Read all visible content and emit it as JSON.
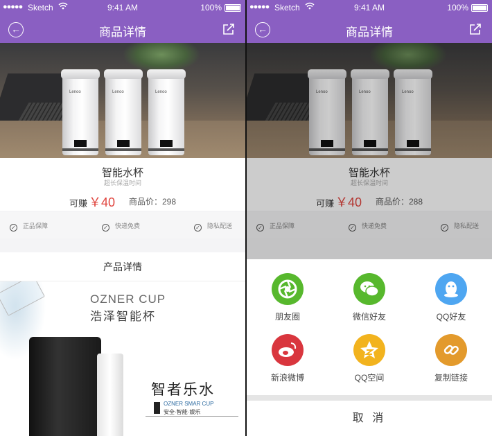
{
  "status_bar": {
    "signal": "●●●●●",
    "carrier": "Sketch",
    "time": "9:41 AM",
    "battery": "100%"
  },
  "nav": {
    "title": "商品详情"
  },
  "product": {
    "name": "智能水杯",
    "subtitle": "超长保温时间",
    "earn_label": "可赚",
    "earn_amount": "￥40",
    "price_label_left": "商品价：298",
    "price_label_right": "商品价：288",
    "cup_brand": "Lenoo"
  },
  "guarantees": [
    "正品保障",
    "快递免费",
    "隐私配送"
  ],
  "detail": {
    "title": "产品详情",
    "promo_en": "OZNER CUP",
    "promo_cn": "浩泽智能杯",
    "slogan": "智者乐水",
    "logo_line1": "OZNER SMAR CUP",
    "logo_line2": "安全·智能·娱乐"
  },
  "share_sheet": {
    "options": [
      {
        "label": "朋友圈",
        "icon": "moments-icon",
        "color": "#57b82d"
      },
      {
        "label": "微信好友",
        "icon": "wechat-icon",
        "color": "#57b82d"
      },
      {
        "label": "QQ好友",
        "icon": "qq-icon",
        "color": "#4ea6f1"
      },
      {
        "label": "新浪微博",
        "icon": "weibo-icon",
        "color": "#d9363e"
      },
      {
        "label": "QQ空间",
        "icon": "qzone-icon",
        "color": "#f2b31e"
      },
      {
        "label": "复制链接",
        "icon": "link-icon",
        "color": "#e39a2c"
      }
    ],
    "cancel": "取 消"
  }
}
